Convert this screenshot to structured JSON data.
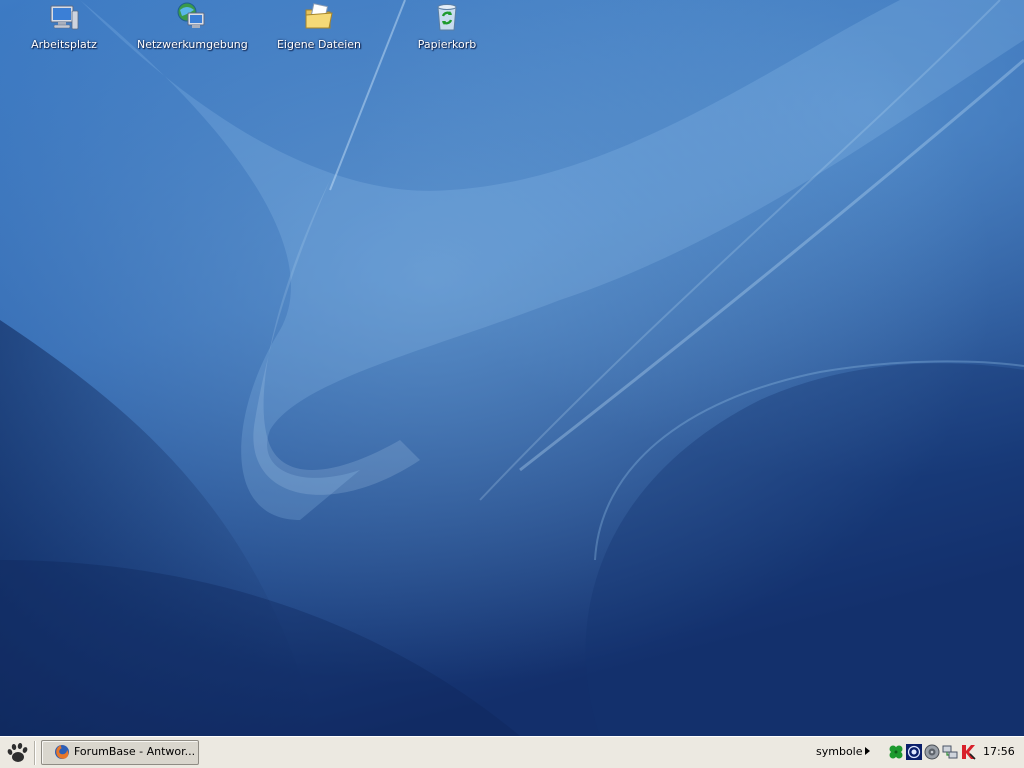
{
  "desktop": {
    "icons": [
      {
        "label": "Arbeitsplatz",
        "icon": "computer-icon"
      },
      {
        "label": "Netzwerkumgebung",
        "icon": "network-icon"
      },
      {
        "label": "Eigene Dateien",
        "icon": "folder-icon"
      },
      {
        "label": "Papierkorb",
        "icon": "recycle-bin-icon"
      }
    ],
    "wallpaper": {
      "base_color": "#2b5aa3",
      "highlight_color": "#8fc0e8"
    }
  },
  "taskbar": {
    "start_icon": "paw-icon",
    "tasks": [
      {
        "label": "ForumBase - Antwor...",
        "icon": "firefox-icon",
        "active": false
      }
    ],
    "tray": {
      "label": "symbole",
      "icons": [
        "clover-icon",
        "eye-icon",
        "speaker-icon",
        "network-tray-icon",
        "antivirus-icon"
      ]
    },
    "clock": "17:56"
  }
}
